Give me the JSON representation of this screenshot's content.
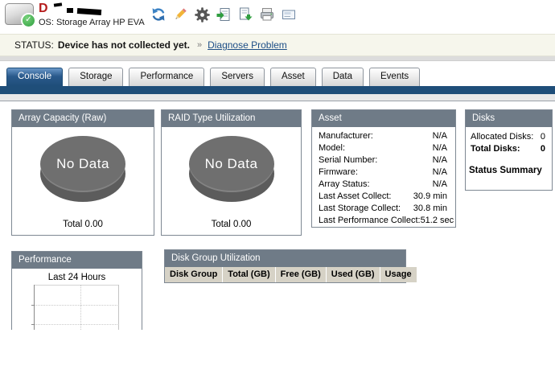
{
  "header": {
    "device_name_visible": "D",
    "os_label": "OS: Storage Array HP EVA"
  },
  "status_bar": {
    "label": "STATUS:",
    "message": "Device has not collected yet.",
    "separator": "»",
    "link": "Diagnose Problem"
  },
  "tabs": [
    {
      "label": "Console",
      "active": true
    },
    {
      "label": "Storage",
      "active": false
    },
    {
      "label": "Performance",
      "active": false
    },
    {
      "label": "Servers",
      "active": false
    },
    {
      "label": "Asset",
      "active": false
    },
    {
      "label": "Data",
      "active": false
    },
    {
      "label": "Events",
      "active": false
    }
  ],
  "panels": {
    "array_capacity": {
      "title": "Array Capacity (Raw)",
      "no_data_label": "No Data",
      "total_label": "Total 0.00"
    },
    "raid_utilization": {
      "title": "RAID Type Utilization",
      "no_data_label": "No Data",
      "total_label": "Total 0.00"
    },
    "asset": {
      "title": "Asset",
      "rows": [
        {
          "label": "Manufacturer:",
          "value": "N/A"
        },
        {
          "label": "Model:",
          "value": "N/A"
        },
        {
          "label": "Serial Number:",
          "value": "N/A"
        },
        {
          "label": "Firmware:",
          "value": "N/A"
        },
        {
          "label": "Array Status:",
          "value": "N/A"
        },
        {
          "label": "Last Asset Collect:",
          "value": "30.9 min"
        },
        {
          "label": "Last Storage Collect:",
          "value": "30.8 min"
        },
        {
          "label": "Last Performance Collect:",
          "value": "51.2 sec"
        }
      ]
    },
    "disks": {
      "title": "Disks",
      "rows": [
        {
          "label": "Allocated Disks:",
          "value": "0"
        },
        {
          "label": "Total Disks:",
          "value": "0"
        }
      ],
      "summary_label": "Status Summary"
    },
    "performance": {
      "title": "Performance",
      "chart_title": "Last 24 Hours"
    },
    "disk_group": {
      "title": "Disk Group Utilization",
      "columns": [
        "Disk Group",
        "Total (GB)",
        "Free (GB)",
        "Used (GB)",
        "Usage"
      ],
      "rows": []
    }
  },
  "colors": {
    "panel_header": "#6f7b87",
    "navy_bar": "#1f4e79",
    "table_header_bg": "#d6d2c6",
    "status_bg": "#f6f6ec",
    "pie_gray": "#6f6f6f",
    "link_blue": "#1d4e86"
  }
}
